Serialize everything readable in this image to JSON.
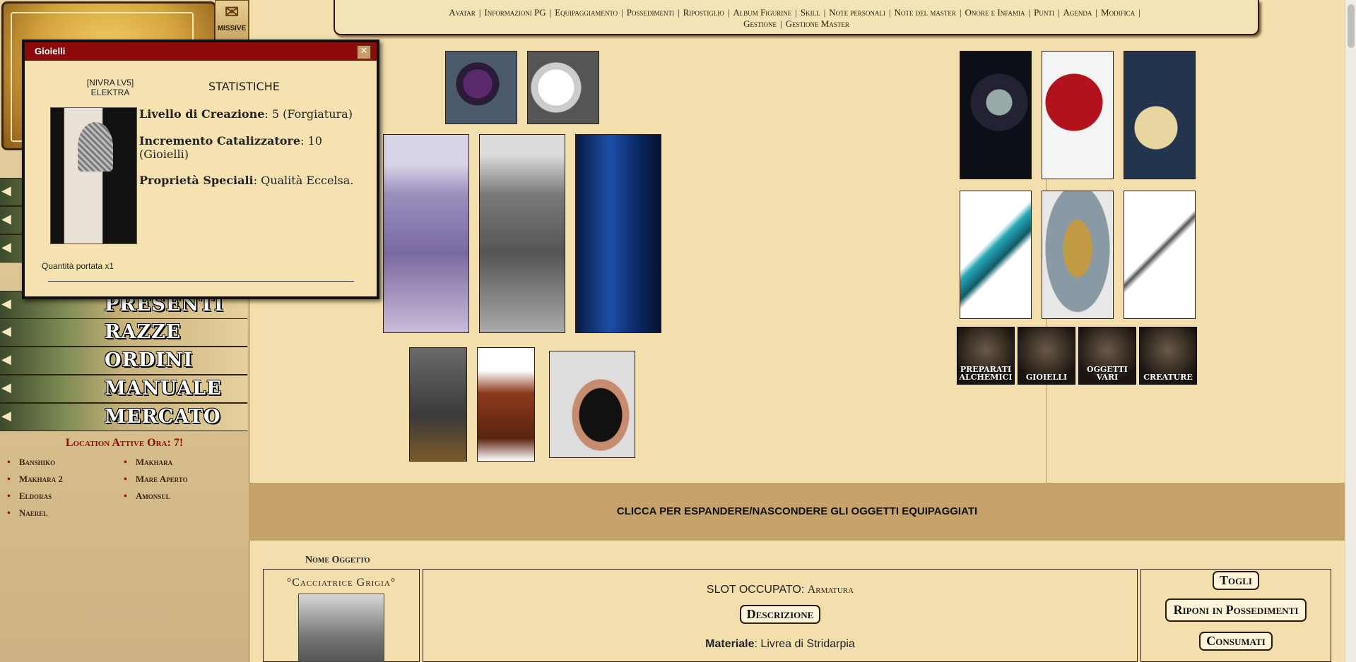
{
  "sidebar": {
    "missive_label": "MISSIVE",
    "nav_items": [
      "PRESENTI",
      "RAZZE",
      "ORDINI",
      "MANUALE",
      "MERCATO"
    ],
    "locations_title": "Location Attive Ora: 7!",
    "locations": [
      "Banshiko",
      "Makhara",
      "Makhara 2",
      "Mare Aperto",
      "Eldoras",
      "Amonsul",
      "Naerel"
    ]
  },
  "topmenu": {
    "items": [
      "Avatar",
      "Informazioni PG",
      "Equipaggiamento",
      "Possedimenti",
      "Ripostiglio",
      "Album Figurine",
      "Skill",
      "Note personali",
      "Note del master",
      "Onore e Infamia",
      "Punti",
      "Agenda",
      "Modifica",
      "Gestione",
      "Gestione Master"
    ]
  },
  "categories": [
    "PREPARATI ALCHEMICI",
    "GIOIELLI",
    "OGGETTI VARI",
    "CREATURE"
  ],
  "expand_bar": "CLICCA PER ESPANDERE/NASCONDERE GLI OGGETTI EQUIPAGGIATI",
  "table": {
    "name_header": "Nome Oggetto",
    "item_name": "°Cacciatrice Grigia°",
    "slot_label": "SLOT OCCUPATO: ",
    "slot_value": "Armatura",
    "description_button": "Descrizione",
    "material_label": "Materiale",
    "material_value": ": Livrea di Stridarpia",
    "actions": [
      "Togli",
      "Riponi in Possedimenti",
      "Consumati"
    ]
  },
  "popup": {
    "title": "Gioielli",
    "owner_line1": "[NIVRA LV5]",
    "owner_line2": "ELEKTRA",
    "stats_heading": "STATISTICHE",
    "stats": [
      {
        "label": "Livello di Creazione",
        "value": ": 5 (Forgiatura)"
      },
      {
        "label": "Incremento Catalizzatore",
        "value": ": 10 (Gioielli)"
      },
      {
        "label": "Proprietà Speciali",
        "value": ": Qualità Eccelsa."
      }
    ],
    "quantity": "Quantità portata x1"
  },
  "icons": {
    "close": "close-icon",
    "chevron": "chevron-left-icon",
    "scroll": "scroll-icon"
  },
  "colors": {
    "background": "#f2dfad",
    "accent_red": "#8b0a0a",
    "expand_bar": "#c6a36b"
  }
}
